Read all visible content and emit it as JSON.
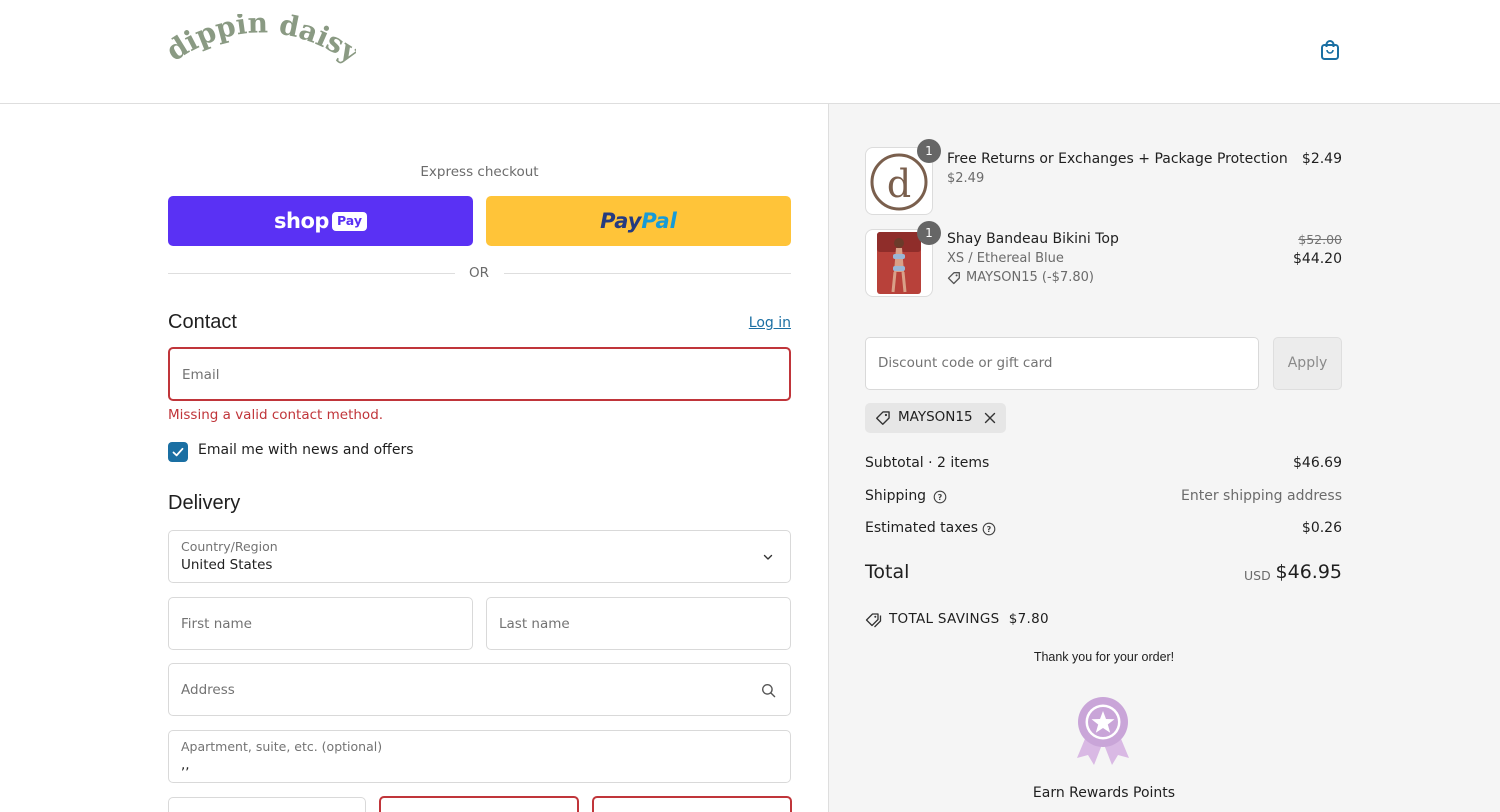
{
  "brand": {
    "logo_text": "dippin daisys"
  },
  "header": {
    "cart_icon": "shopping-bag-icon"
  },
  "express": {
    "title": "Express checkout",
    "shop_pay": {
      "word": "shop",
      "pill": "Pay"
    },
    "paypal": {
      "part1": "Pay",
      "part2": "Pal"
    },
    "divider": "OR"
  },
  "contact": {
    "title": "Contact",
    "login": "Log in",
    "email_placeholder": "Email",
    "error": "Missing a valid contact method.",
    "newsletter_label": "Email me with news and offers",
    "newsletter_checked": true
  },
  "delivery": {
    "title": "Delivery",
    "country_label": "Country/Region",
    "country_value": "United States",
    "first_name_placeholder": "First name",
    "last_name_placeholder": "Last name",
    "address_placeholder": "Address",
    "apartment_label": "Apartment, suite, etc. (optional)",
    "apartment_value": ",,"
  },
  "order": {
    "items": [
      {
        "qty": "1",
        "title": "Free Returns or Exchanges + Package Protection",
        "unit_price": "$2.49",
        "price": "$2.49",
        "thumb_letter": "d"
      },
      {
        "qty": "1",
        "title": "Shay Bandeau Bikini Top",
        "variant": "XS / Ethereal Blue",
        "discount": "MAYSON15 (-$7.80)",
        "original_price": "$52.00",
        "price": "$44.20"
      }
    ],
    "discount_placeholder": "Discount code or gift card",
    "apply": "Apply",
    "applied_code": "MAYSON15",
    "subtotal_label": "Subtotal · 2 items",
    "subtotal_value": "$46.69",
    "shipping_label": "Shipping",
    "shipping_value": "Enter shipping address",
    "taxes_label": "Estimated taxes",
    "taxes_value": "$0.26",
    "total_label": "Total",
    "total_currency": "USD",
    "total_value": "$46.95",
    "savings_label": "TOTAL SAVINGS",
    "savings_value": "$7.80",
    "thanks": "Thank you for your order!",
    "rewards": "Earn Rewards Points"
  },
  "colors": {
    "accent": "#1a6fa3",
    "shop_pay": "#5a31f4",
    "paypal": "#ffc439",
    "error": "#c0353a",
    "rewards": "#c9a5d8"
  }
}
